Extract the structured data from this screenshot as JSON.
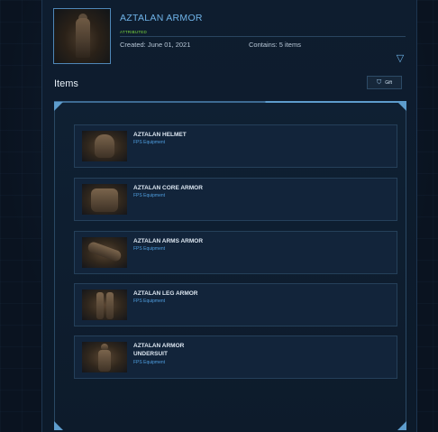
{
  "pack": {
    "title": "AZTALAN ARMOR",
    "badge": "ATTRIBUTED",
    "created": "Created: June 01, 2021",
    "contains": "Contains: 5 items"
  },
  "section": {
    "title": "Items",
    "gift_label": "Gift"
  },
  "items": [
    {
      "name": "AZTALAN HELMET",
      "category": "FPS Equipment"
    },
    {
      "name": "AZTALAN CORE ARMOR",
      "category": "FPS Equipment"
    },
    {
      "name": "AZTALAN ARMS ARMOR",
      "category": "FPS Equipment"
    },
    {
      "name": "AZTALAN LEG ARMOR",
      "category": "FPS Equipment"
    },
    {
      "name": "AZTALAN ARMOR\nUNDERSUIT",
      "category": "FPS Equipment"
    }
  ],
  "colors": {
    "accent": "#6fb3e8",
    "badge": "#7cdc3c",
    "category": "#4f9fe0",
    "background": "#0b1420"
  },
  "icons": {
    "expand": "chevron-down-icon",
    "gift": "gift-icon"
  }
}
